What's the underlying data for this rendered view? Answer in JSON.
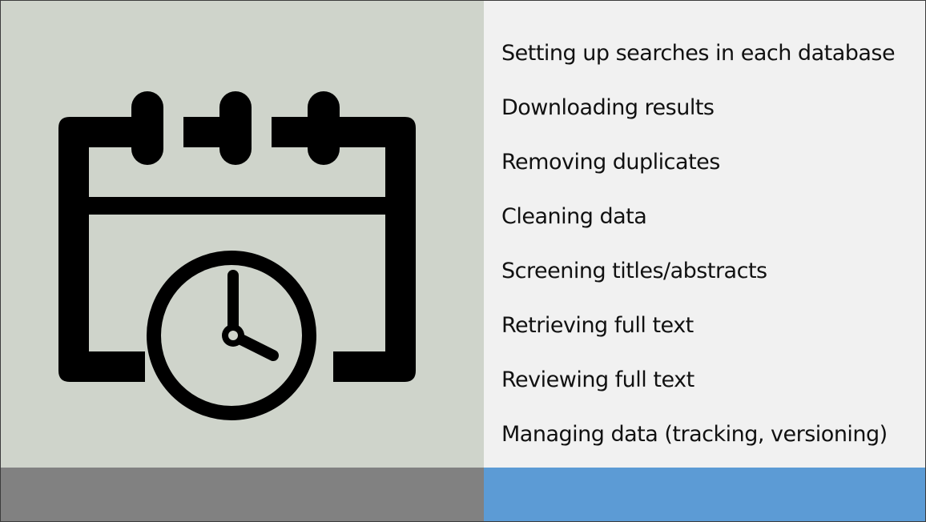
{
  "colors": {
    "left_panel": "#cfd4cb",
    "right_panel": "#f1f1f1",
    "bottom_left_bar": "#818181",
    "bottom_right_bar": "#5c9bd5",
    "icon": "#000000",
    "text": "#111111"
  },
  "icon": "calendar-clock-icon",
  "tasks": [
    "Setting up searches in each database",
    "Downloading results",
    "Removing duplicates",
    "Cleaning data",
    "Screening titles/abstracts",
    "Retrieving full text",
    "Reviewing full text",
    "Managing data (tracking, versioning)"
  ]
}
